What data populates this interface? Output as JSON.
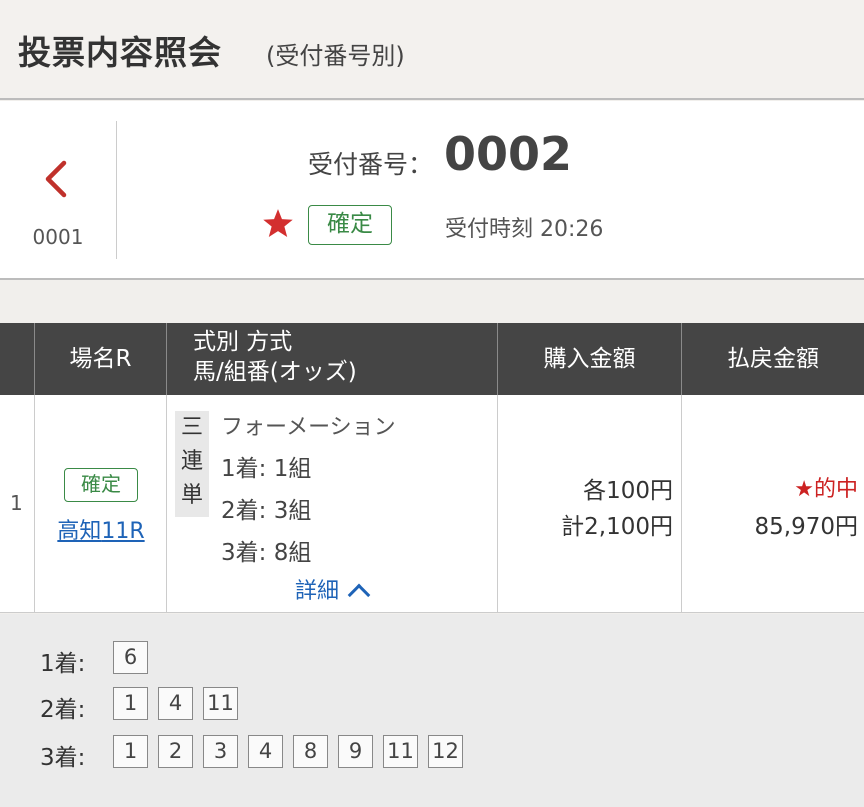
{
  "header": {
    "title": "投票内容照会",
    "subtitle": "(受付番号別)"
  },
  "receipt": {
    "prev_number": "0001",
    "number_label": "受付番号：",
    "number": "0002",
    "status": "確定",
    "time_label": "受付時刻",
    "time": "20:26"
  },
  "table": {
    "headers": {
      "place": "場名R",
      "type_line1": "式別 方式",
      "type_line2": "馬/組番(オッズ)",
      "buy": "購入金額",
      "pay": "払戻金額"
    },
    "rows": [
      {
        "index": "1",
        "status": "確定",
        "place": "高知",
        "race": "11R",
        "bet_type_chars": [
          "三",
          "連",
          "単"
        ],
        "method": "フォーメーション",
        "combos": [
          "1着: 1組",
          "2着: 3組",
          "3着: 8組"
        ],
        "detail_label": "詳細",
        "buy_each": "各100円",
        "buy_total": "計2,100円",
        "hit_label": "★的中",
        "payout": "85,970円"
      }
    ]
  },
  "horses": {
    "first_label": "1着:",
    "first": [
      "6"
    ],
    "second_label": "2着:",
    "second": [
      "1",
      "4",
      "11"
    ],
    "third_label": "3着:",
    "third": [
      "1",
      "2",
      "3",
      "4",
      "8",
      "9",
      "11",
      "12"
    ]
  },
  "colors": {
    "accent_red": "#c22",
    "confirm_green": "#3a8a46",
    "link_blue": "#1e63b7",
    "header_dark": "#454545"
  }
}
